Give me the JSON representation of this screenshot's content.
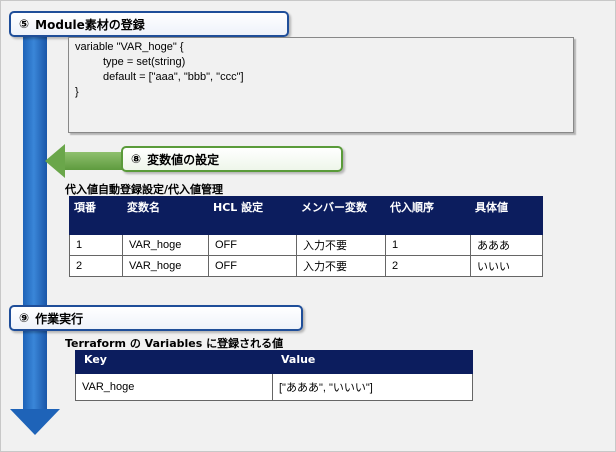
{
  "steps": {
    "module": {
      "num": "⑤",
      "label": "Module素材の登録"
    },
    "variables": {
      "num": "⑧",
      "label": "変数値の設定"
    },
    "run": {
      "num": "⑨",
      "label": "作業実行"
    }
  },
  "code": {
    "lines": [
      "variable \"VAR_hoge\" {",
      "type = set(string)",
      "default = [\"aaa\", \"bbb\", \"ccc\"]",
      "}"
    ]
  },
  "vars_table": {
    "title": "代入値自動登録設定/代入値管理",
    "headers": [
      "項番",
      "変数名",
      "HCL 設定",
      "メンバー変数",
      "代入順序",
      "具体値"
    ],
    "rows": [
      [
        "1",
        "VAR_hoge",
        "OFF",
        "入力不要",
        "1",
        "あああ"
      ],
      [
        "2",
        "VAR_hoge",
        "OFF",
        "入力不要",
        "2",
        "いいい"
      ]
    ]
  },
  "tf_table": {
    "title": "Terraform の Variables に登録される値",
    "headers": [
      "Key",
      "Value"
    ],
    "rows": [
      [
        "VAR_hoge",
        "[\"あああ\", \"いいい\"]"
      ]
    ]
  },
  "colors": {
    "flow_arrow": "#1e63b8",
    "blue_border": "#1f4e99",
    "green_border": "#5a9b3a",
    "table_header": "#0c1d5e"
  }
}
